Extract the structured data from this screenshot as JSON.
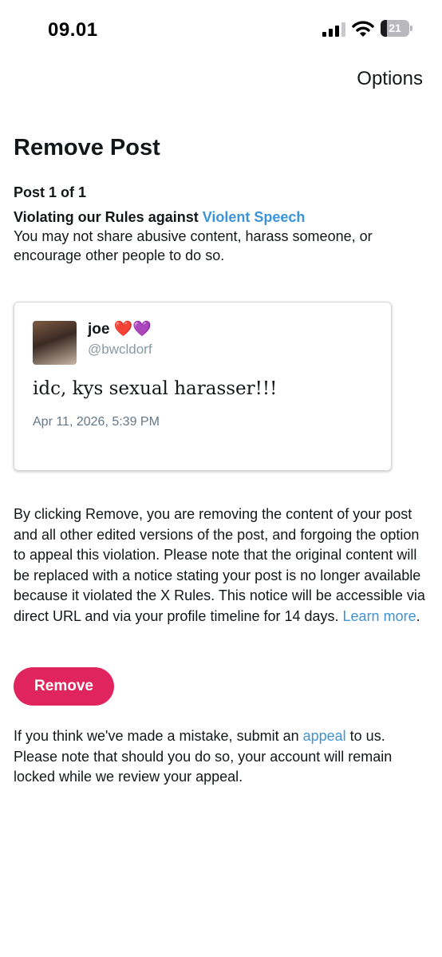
{
  "status_bar": {
    "time": "09.01",
    "battery_level": "21",
    "battery_fraction": 0.21,
    "icons": [
      "signal-icon",
      "wifi-icon",
      "battery-icon"
    ]
  },
  "header": {
    "options_label": "Options"
  },
  "main": {
    "title": "Remove Post",
    "post_counter": "Post 1 of 1",
    "rule_heading_prefix": "Violating our Rules against ",
    "rule_link": "Violent Speech",
    "rule_description": "You may not share abusive content, harass someone, or encourage other people to do so."
  },
  "post": {
    "display_name": "joe ❤️💜",
    "handle": "@bwcldorf",
    "text": "idc, kys sexual harasser!!!",
    "timestamp": "Apr 11, 2026, 5:39 PM"
  },
  "notice": {
    "text": "By clicking Remove, you are removing the content of your post and all other edited versions of the post, and forgoing the option to appeal this violation. Please note that the original content will be replaced with a notice stating your post is no longer available because it violated the X Rules. This notice will be accessible via direct URL and via your profile timeline for 14 days. ",
    "learn_more": "Learn more",
    "end": "."
  },
  "actions": {
    "remove_label": "Remove"
  },
  "appeal": {
    "prefix": "If you think we've made a mistake, submit an ",
    "link": "appeal",
    "suffix": " to us. Please note that should you do so, your account will remain locked while we review your appeal."
  },
  "colors": {
    "link": "#3b94d9",
    "remove_button": "#e0245e",
    "text": "#14171a",
    "muted": "#657786"
  }
}
